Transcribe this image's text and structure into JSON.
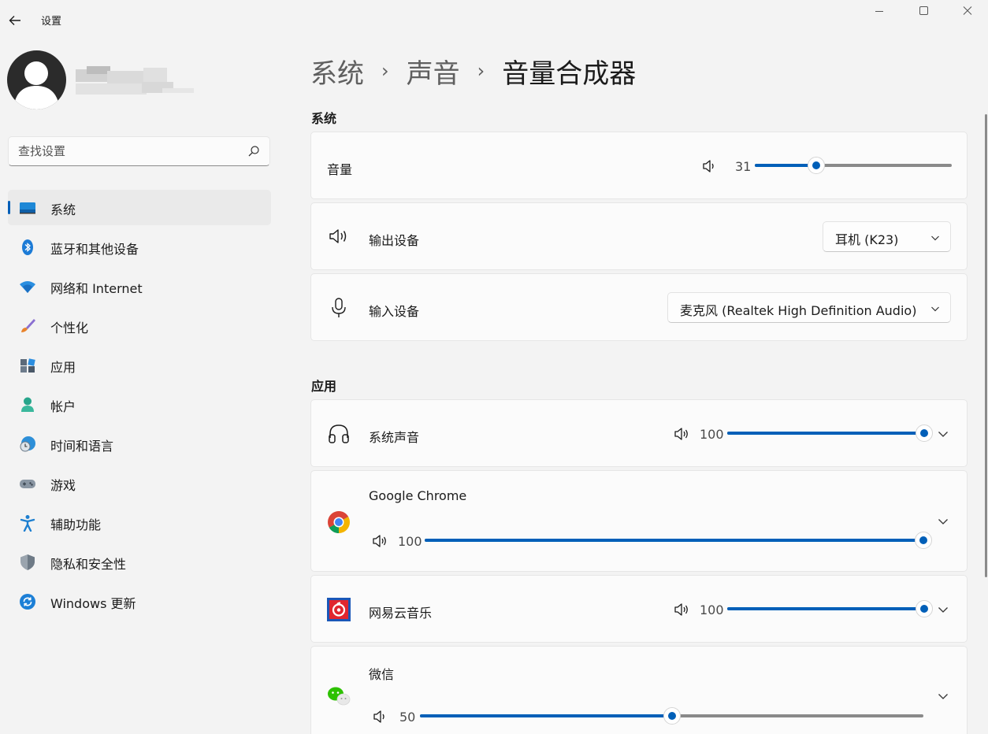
{
  "window": {
    "title": "设置"
  },
  "search": {
    "placeholder": "查找设置"
  },
  "sidebar": {
    "items": [
      {
        "label": "系统",
        "icon": "system-icon",
        "active": true
      },
      {
        "label": "蓝牙和其他设备",
        "icon": "bluetooth-icon"
      },
      {
        "label": "网络和 Internet",
        "icon": "network-icon"
      },
      {
        "label": "个性化",
        "icon": "brush-icon"
      },
      {
        "label": "应用",
        "icon": "apps-icon"
      },
      {
        "label": "帐户",
        "icon": "account-icon"
      },
      {
        "label": "时间和语言",
        "icon": "globe-clock-icon"
      },
      {
        "label": "游戏",
        "icon": "gamepad-icon"
      },
      {
        "label": "辅助功能",
        "icon": "accessibility-icon"
      },
      {
        "label": "隐私和安全性",
        "icon": "shield-icon"
      },
      {
        "label": "Windows 更新",
        "icon": "update-icon"
      }
    ]
  },
  "breadcrumb": {
    "level1": "系统",
    "level2": "声音",
    "current": "音量合成器",
    "separator": "›"
  },
  "system_section": {
    "title": "系统",
    "volume": {
      "label": "音量",
      "value": "31",
      "level": 0.31
    },
    "output": {
      "label": "输出设备",
      "selected": "耳机 (K23)"
    },
    "input": {
      "label": "输入设备",
      "selected": "麦克风 (Realtek High Definition Audio)"
    }
  },
  "apps_section": {
    "title": "应用",
    "apps": [
      {
        "name": "系统声音",
        "volume": "100",
        "level": 1.0,
        "icon": "headphones-icon"
      },
      {
        "name": "Google Chrome",
        "volume": "100",
        "level": 1.0,
        "icon": "chrome-icon"
      },
      {
        "name": "网易云音乐",
        "volume": "100",
        "level": 1.0,
        "icon": "netease-music-icon"
      },
      {
        "name": "微信",
        "volume": "50",
        "level": 0.5,
        "icon": "wechat-icon"
      }
    ]
  },
  "colors": {
    "accent": "#005fb8",
    "background": "#f3f3f3",
    "card": "#fbfbfb"
  }
}
